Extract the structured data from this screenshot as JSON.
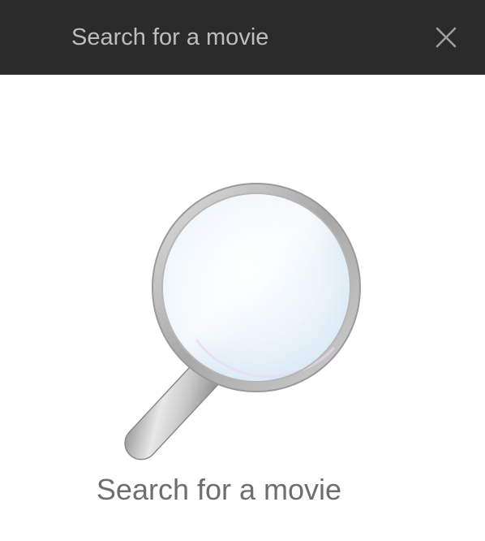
{
  "search": {
    "placeholder": "Search for a movie",
    "value": "",
    "close_icon": "close-icon",
    "bar_color": "#2b2b2b"
  },
  "empty_state": {
    "icon": "magnifying-glass-icon",
    "message": "Search for a movie"
  }
}
